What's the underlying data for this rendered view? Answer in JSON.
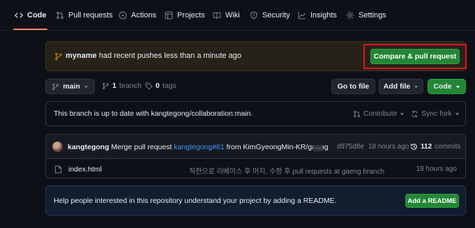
{
  "nav": {
    "tabs": [
      {
        "label": "Code",
        "icon": "code-icon",
        "active": true
      },
      {
        "label": "Pull requests",
        "icon": "pull-request-icon"
      },
      {
        "label": "Actions",
        "icon": "play-icon"
      },
      {
        "label": "Projects",
        "icon": "table-icon"
      },
      {
        "label": "Wiki",
        "icon": "book-icon"
      },
      {
        "label": "Security",
        "icon": "shield-icon"
      },
      {
        "label": "Insights",
        "icon": "graph-icon"
      },
      {
        "label": "Settings",
        "icon": "gear-icon"
      }
    ]
  },
  "banner": {
    "user": "myname",
    "message": "had recent pushes less than a minute ago",
    "button": "Compare & pull request"
  },
  "toolbar": {
    "branch": "main",
    "branch_count": "1",
    "branch_word": "branch",
    "tag_count": "0",
    "tag_word": "tags",
    "goto_file": "Go to file",
    "add_file": "Add file",
    "code": "Code"
  },
  "branch_status": {
    "text": "This branch is up to date with kangtegong/collaboration:main.",
    "contribute": "Contribute",
    "sync_fork": "Sync fork"
  },
  "latest_commit": {
    "author": "kangtegong",
    "message_prefix": "Merge pull request",
    "pr_ref": "kangtegong#61",
    "message_suffix": "from KimGyeongMin-KR/gaeng",
    "ellipsis": "...",
    "sha": "d975d8e",
    "time": "18 hours ago",
    "commit_count": "112",
    "commits_word": "commits"
  },
  "files": [
    {
      "name": "index.html",
      "message": "직전으로 리베이스 후 머지, 수정 후 pull requests at gaeng branch",
      "time": "18 hours ago"
    }
  ],
  "readme": {
    "text": "Help people interested in this repository understand your project by adding a README.",
    "button": "Add a README"
  },
  "colors": {
    "accent_green": "#238636",
    "highlight_red": "#e5141c",
    "link_blue": "#4493f8",
    "active_tab_underline": "#f78166"
  }
}
